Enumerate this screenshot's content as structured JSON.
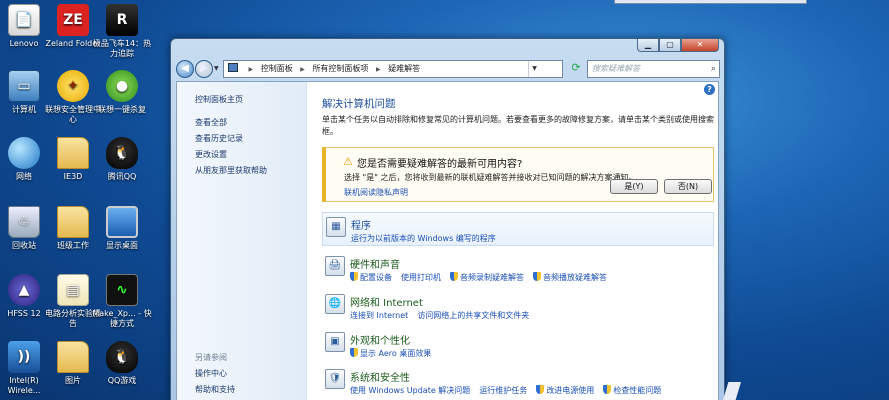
{
  "desktop_icons": [
    {
      "label": "Lenovo",
      "icon": "document-icon",
      "glyph": "📄"
    },
    {
      "label": "Zeland Folder",
      "icon": "zeland-icon",
      "glyph": "ZE"
    },
    {
      "label": "极品飞车14：热力追踪",
      "icon": "racing-game-icon",
      "glyph": "R"
    },
    {
      "label": "计算机",
      "icon": "computer-icon",
      "glyph": "▭"
    },
    {
      "label": "联想安全管理中心",
      "icon": "shield-icon",
      "glyph": "✦"
    },
    {
      "label": "联想一键杀复",
      "icon": "antivirus-icon",
      "glyph": "●"
    },
    {
      "label": "网络",
      "icon": "network-globe-icon",
      "glyph": ""
    },
    {
      "label": "IE3D",
      "icon": "folder-icon",
      "glyph": ""
    },
    {
      "label": "腾讯QQ",
      "icon": "qq-penguin-icon",
      "glyph": "🐧"
    },
    {
      "label": "回收站",
      "icon": "recycle-bin-icon",
      "glyph": "♲"
    },
    {
      "label": "班级工作",
      "icon": "folder-icon",
      "glyph": ""
    },
    {
      "label": "显示桌面",
      "icon": "show-desktop-icon",
      "glyph": ""
    },
    {
      "label": "HFSS 12",
      "icon": "hfss-icon",
      "glyph": "▲"
    },
    {
      "label": "电路分析实验报告",
      "icon": "paper-file-icon",
      "glyph": "▤"
    },
    {
      "label": "Make_Xp... - 快捷方式",
      "icon": "waveform-shortcut-icon",
      "glyph": "∿"
    },
    {
      "label": "Intel(R) Wirele...",
      "icon": "wireless-icon",
      "glyph": "))"
    },
    {
      "label": "图片",
      "icon": "folder-icon",
      "glyph": ""
    },
    {
      "label": "QQ游戏",
      "icon": "qq-game-icon",
      "glyph": "🐧"
    }
  ],
  "window": {
    "nav": {
      "back": "◀",
      "forward": "▶"
    },
    "address": {
      "crumbs": [
        "控制面板",
        "所有控制面板项",
        "疑难解答"
      ],
      "separator": "▶"
    },
    "search_placeholder": "搜索疑难解答",
    "sidebar": {
      "links": [
        "控制面板主页",
        "查看全部",
        "查看历史记录",
        "更改设置",
        "从朋友那里获取帮助"
      ],
      "see_also_heading": "另请参阅",
      "see_also": [
        "操作中心",
        "帮助和支持"
      ]
    },
    "main": {
      "title": "解决计算机问题",
      "description": "单击某个任务以自动排除和修复常见的计算机问题。若要查看更多的故障修复方案，请单击某个类别或使用搜索框。",
      "notice": {
        "question": "您是否需要疑难解答的最新可用内容?",
        "message": "选择 \"是\" 之后，您将收到最新的联机疑难解答并接收对已知问题的解决方案通知。",
        "privacy_link": "联机阅读隐私声明",
        "yes": "是(Y)",
        "no": "否(N)"
      },
      "categories": [
        {
          "name": "程序",
          "icon": "programs-icon",
          "glyph": "▦",
          "links": [
            "运行为以前版本的 Windows 编写的程序"
          ],
          "uac": [
            false
          ]
        },
        {
          "name": "硬件和声音",
          "icon": "hardware-sound-icon",
          "glyph": "🖨",
          "links": [
            "配置设备",
            "使用打印机",
            "音频录制疑难解答",
            "音频播放疑难解答"
          ],
          "uac": [
            true,
            false,
            true,
            true
          ]
        },
        {
          "name": "网络和 Internet",
          "icon": "network-internet-icon",
          "glyph": "🌐",
          "links": [
            "连接到 Internet",
            "访问网络上的共享文件和文件夹"
          ],
          "uac": [
            false,
            false
          ]
        },
        {
          "name": "外观和个性化",
          "icon": "appearance-icon",
          "glyph": "▣",
          "links": [
            "显示 Aero 桌面效果"
          ],
          "uac": [
            true
          ]
        },
        {
          "name": "系统和安全性",
          "icon": "system-security-icon",
          "glyph": "🛡",
          "links": [
            "使用 Windows Update 解决问题",
            "运行维护任务",
            "改进电源使用",
            "检查性能问题"
          ],
          "uac": [
            false,
            false,
            true,
            true
          ]
        }
      ]
    }
  }
}
